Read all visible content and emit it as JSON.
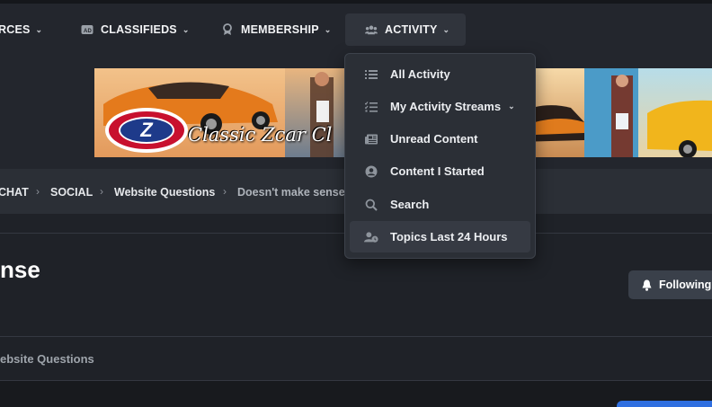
{
  "nav": {
    "resources": "RCES",
    "classifieds": "CLASSIFIEDS",
    "membership": "MEMBERSHIP",
    "activity": "ACTIVITY"
  },
  "banner": {
    "logo_letter": "Z",
    "logo_script": "Classic Zcar Cl"
  },
  "activity_menu": [
    {
      "label": "All Activity",
      "icon": "list-icon"
    },
    {
      "label": "My Activity Streams",
      "icon": "checklist-icon"
    },
    {
      "label": "Unread Content",
      "icon": "newspaper-icon"
    },
    {
      "label": "Content I Started",
      "icon": "user-circle-icon"
    },
    {
      "label": "Search",
      "icon": "search-icon"
    },
    {
      "label": "Topics Last 24 Hours",
      "icon": "user-clock-icon"
    }
  ],
  "breadcrumb": {
    "item1": "CHAT",
    "item2": "SOCIAL",
    "item3": "Website Questions",
    "item4": "Doesn't make sense"
  },
  "page": {
    "title": "nse",
    "follow_label": "Following",
    "forum_label": "ebsite Questions"
  },
  "colors": {
    "background": "#1f2228",
    "nav_background": "#23262d",
    "dropdown_background": "#2b2f36",
    "accent_blue": "#2f6fe0"
  }
}
